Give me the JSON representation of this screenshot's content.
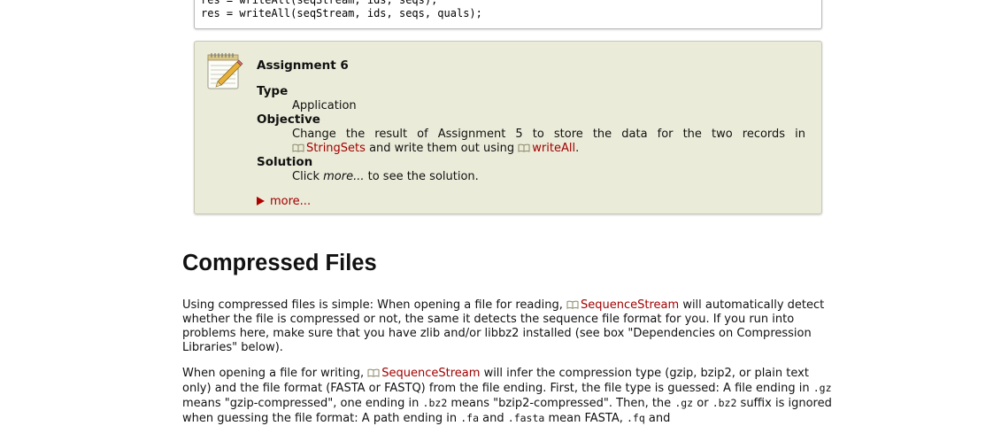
{
  "code": {
    "lines": [
      "res = writeAll(seqStream, ids, seqs);",
      "res = writeAll(seqStream, ids, seqs, quals);"
    ]
  },
  "assignment": {
    "icon": "notepad-pencil-icon",
    "title": "Assignment 6",
    "type_label": "Type",
    "type_value": "Application",
    "objective_label": "Objective",
    "objective_text_1": "Change the result of Assignment 5 to store the data for the two records in",
    "objective_link_1": "StringSets",
    "objective_text_2": "and write them out using",
    "objective_link_2": "writeAll",
    "objective_text_3": ".",
    "solution_label": "Solution",
    "solution_text_1": "Click",
    "solution_more": "more...",
    "solution_text_2": "to see the solution.",
    "more_link": "more..."
  },
  "section": {
    "heading": "Compressed Files",
    "p1_text_1": "Using compressed files is simple: When opening a file for reading,",
    "p1_link": "SequenceStream",
    "p1_text_2": "will automatically detect whether the file is compressed or not, the same it detects the sequence file format for you. If you run into problems here, make sure that you have zlib and/or libbz2 installed (see box \"Dependencies on Compression Libraries\" below).",
    "p2_text_1": "When opening a file for writing,",
    "p2_link": "SequenceStream",
    "p2_text_2": "will infer the compression type (gzip, bzip2, or plain text only) and the file format (FASTA or FASTQ) from the file ending. First, the file type is guessed: A file ending in",
    "p2_code_1": ".gz",
    "p2_text_3": "means \"gzip-compressed\", one ending in",
    "p2_code_2": ".bz2",
    "p2_text_4": "means \"bzip2-compressed\". Then, the",
    "p2_code_3": ".gz",
    "p2_text_5": "or",
    "p2_code_4": ".bz2",
    "p2_text_6": "suffix is ignored when guessing the file format: A path ending in",
    "p2_code_5": ".fa",
    "p2_text_7": "and",
    "p2_code_6": ".fasta",
    "p2_text_8": "mean FASTA,",
    "p2_code_7": ".fq",
    "p2_text_9": "and"
  },
  "colors": {
    "link": "#a00000",
    "assignment_bg": "#ebebd9"
  }
}
